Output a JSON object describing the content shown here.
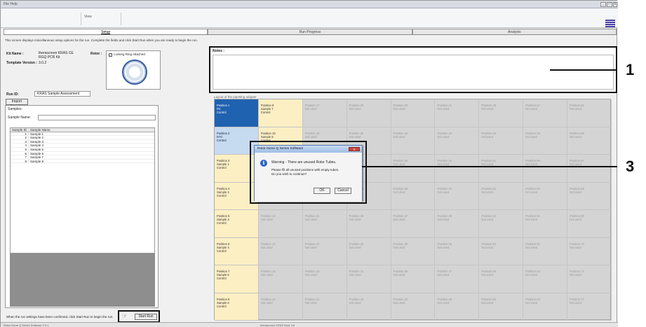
{
  "menubar": {
    "text": "File  Help"
  },
  "toolbar": {
    "view_label": "View"
  },
  "tabs": [
    "Setup",
    "Run Progress",
    "Analysis"
  ],
  "setup": {
    "info_text": "This screen displays miscellaneous setup options for the run. Complete the fields and click Start Run when you are ready to begin the run.",
    "kit_name_label": "Kit Name :",
    "kit_name_value_1": "therascreen KRAS CE",
    "kit_name_value_2": "RGQ PCR Kit",
    "template_version_label": "Template Version :",
    "template_version_value": "3.0.2",
    "rotor_label": "Rotor :",
    "locking_ring_label": "Locking Ring Attached",
    "run_id_label": "Run ID:",
    "run_id_value": "KRAS Sample Assessment",
    "import_samples_label": "Import Samples",
    "samples_label": "Samples:",
    "sample_name_label": "Sample Name:",
    "sample_name_value": "",
    "table_headers": [
      "Sample ID",
      "Sample Name"
    ],
    "samples": [
      {
        "id": "1",
        "name": "Sample 1"
      },
      {
        "id": "2",
        "name": "Sample 2"
      },
      {
        "id": "3",
        "name": "Sample 3"
      },
      {
        "id": "4",
        "name": "Sample 4"
      },
      {
        "id": "5",
        "name": "Sample 5"
      },
      {
        "id": "6",
        "name": "Sample 6"
      },
      {
        "id": "7",
        "name": "Sample 7"
      },
      {
        "id": "8",
        "name": "Sample 8"
      }
    ],
    "bottom_message": "When the run settings have been confirmed, click Start Run to begin the run.",
    "start_run_label": "Start Run",
    "notes_label": "Notes :",
    "grid_caption": "Layout of the pipetting adapter"
  },
  "grid": {
    "columns": [
      [
        {
          "lines": [
            "Position 1",
            "PC",
            "Control"
          ],
          "kind": "pc"
        },
        {
          "lines": [
            "Position 2",
            "NTC",
            "Control"
          ],
          "kind": "ntc"
        },
        {
          "lines": [
            "Position 3",
            "Sample 1",
            "Control"
          ],
          "kind": "sample"
        },
        {
          "lines": [
            "Position 4",
            "Sample 2",
            "Control"
          ],
          "kind": "sample"
        },
        {
          "lines": [
            "Position 5",
            "Sample 3",
            "Control"
          ],
          "kind": "sample"
        },
        {
          "lines": [
            "Position 6",
            "Sample 4",
            "Control"
          ],
          "kind": "sample"
        },
        {
          "lines": [
            "Position 7",
            "Sample 5",
            "Control"
          ],
          "kind": "sample"
        },
        {
          "lines": [
            "Position 8",
            "Sample 6",
            "Control"
          ],
          "kind": "sample"
        }
      ],
      [
        {
          "lines": [
            "Position 9",
            "Sample 7",
            "Control"
          ],
          "kind": "sample"
        },
        {
          "lines": [
            "Position 10",
            "Sample 8",
            "Control"
          ],
          "kind": "sample"
        },
        {
          "lines": [
            "Position 11",
            "Not used"
          ],
          "kind": "unused"
        },
        {
          "lines": [
            "Position 12",
            "Not used"
          ],
          "kind": "unused"
        },
        {
          "lines": [
            "Position 13",
            "Not used"
          ],
          "kind": "unused"
        },
        {
          "lines": [
            "Position 14",
            "Not used"
          ],
          "kind": "unused"
        },
        {
          "lines": [
            "Position 15",
            "Not used"
          ],
          "kind": "unused"
        },
        {
          "lines": [
            "Position 16",
            "Not used"
          ],
          "kind": "unused"
        }
      ],
      [
        {
          "lines": [
            "Position 17",
            "Not used"
          ],
          "kind": "unused"
        },
        {
          "lines": [
            "Position 18",
            "Not used"
          ],
          "kind": "unused"
        },
        {
          "lines": [
            "Position 19",
            "Not used"
          ],
          "kind": "unused"
        },
        {
          "lines": [
            "Position 20",
            "Not used"
          ],
          "kind": "unused"
        },
        {
          "lines": [
            "Position 21",
            "Not used"
          ],
          "kind": "unused"
        },
        {
          "lines": [
            "Position 22",
            "Not used"
          ],
          "kind": "unused"
        },
        {
          "lines": [
            "Position 23",
            "Not used"
          ],
          "kind": "unused"
        },
        {
          "lines": [
            "Position 24",
            "Not used"
          ],
          "kind": "unused"
        }
      ],
      [
        {
          "lines": [
            "Position 25",
            "Not used"
          ],
          "kind": "unused"
        },
        {
          "lines": [
            "Position 26",
            "Not used"
          ],
          "kind": "unused"
        },
        {
          "lines": [
            "Position 27",
            "Not used"
          ],
          "kind": "unused"
        },
        {
          "lines": [
            "Position 28",
            "Not used"
          ],
          "kind": "unused"
        },
        {
          "lines": [
            "Position 29",
            "Not used"
          ],
          "kind": "unused"
        },
        {
          "lines": [
            "Position 30",
            "Not used"
          ],
          "kind": "unused"
        },
        {
          "lines": [
            "Position 31",
            "Not used"
          ],
          "kind": "unused"
        },
        {
          "lines": [
            "Position 32",
            "Not used"
          ],
          "kind": "unused"
        }
      ],
      [
        {
          "lines": [
            "Position 33",
            "Not used"
          ],
          "kind": "unused"
        },
        {
          "lines": [
            "Position 34",
            "Not used"
          ],
          "kind": "unused"
        },
        {
          "lines": [
            "Position 35",
            "Not used"
          ],
          "kind": "unused"
        },
        {
          "lines": [
            "Position 36",
            "Not used"
          ],
          "kind": "unused"
        },
        {
          "lines": [
            "Position 37",
            "Not used"
          ],
          "kind": "unused"
        },
        {
          "lines": [
            "Position 38",
            "Not used"
          ],
          "kind": "unused"
        },
        {
          "lines": [
            "Position 39",
            "Not used"
          ],
          "kind": "unused"
        },
        {
          "lines": [
            "Position 40",
            "Not used"
          ],
          "kind": "unused"
        }
      ],
      [
        {
          "lines": [
            "Position 41",
            "Not used"
          ],
          "kind": "unused"
        },
        {
          "lines": [
            "Position 42",
            "Not used"
          ],
          "kind": "unused"
        },
        {
          "lines": [
            "Position 43",
            "Not used"
          ],
          "kind": "unused"
        },
        {
          "lines": [
            "Position 44",
            "Not used"
          ],
          "kind": "unused"
        },
        {
          "lines": [
            "Position 45",
            "Not used"
          ],
          "kind": "unused"
        },
        {
          "lines": [
            "Position 46",
            "Not used"
          ],
          "kind": "unused"
        },
        {
          "lines": [
            "Position 47",
            "Not used"
          ],
          "kind": "unused"
        },
        {
          "lines": [
            "Position 48",
            "Not used"
          ],
          "kind": "unused"
        }
      ],
      [
        {
          "lines": [
            "Position 49",
            "Not used"
          ],
          "kind": "unused"
        },
        {
          "lines": [
            "Position 50",
            "Not used"
          ],
          "kind": "unused"
        },
        {
          "lines": [
            "Position 51",
            "Not used"
          ],
          "kind": "unused"
        },
        {
          "lines": [
            "Position 52",
            "Not used"
          ],
          "kind": "unused"
        },
        {
          "lines": [
            "Position 53",
            "Not used"
          ],
          "kind": "unused"
        },
        {
          "lines": [
            "Position 54",
            "Not used"
          ],
          "kind": "unused"
        },
        {
          "lines": [
            "Position 55",
            "Not used"
          ],
          "kind": "unused"
        },
        {
          "lines": [
            "Position 56",
            "Not used"
          ],
          "kind": "unused"
        }
      ],
      [
        {
          "lines": [
            "Position 57",
            "Not used"
          ],
          "kind": "unused"
        },
        {
          "lines": [
            "Position 58",
            "Not used"
          ],
          "kind": "unused"
        },
        {
          "lines": [
            "Position 59",
            "Not used"
          ],
          "kind": "unused"
        },
        {
          "lines": [
            "Position 60",
            "Not used"
          ],
          "kind": "unused"
        },
        {
          "lines": [
            "Position 61",
            "Not used"
          ],
          "kind": "unused"
        },
        {
          "lines": [
            "Position 62",
            "Not used"
          ],
          "kind": "unused"
        },
        {
          "lines": [
            "Position 63",
            "Not used"
          ],
          "kind": "unused"
        },
        {
          "lines": [
            "Position 64",
            "Not used"
          ],
          "kind": "unused"
        }
      ],
      [
        {
          "lines": [
            "Position 65",
            "Not used"
          ],
          "kind": "unused"
        },
        {
          "lines": [
            "Position 66",
            "Not used"
          ],
          "kind": "unused"
        },
        {
          "lines": [
            "Position 67",
            "Not used"
          ],
          "kind": "unused"
        },
        {
          "lines": [
            "Position 68",
            "Not used"
          ],
          "kind": "unused"
        },
        {
          "lines": [
            "Position 69",
            "Not used"
          ],
          "kind": "unused"
        },
        {
          "lines": [
            "Position 70",
            "Not used"
          ],
          "kind": "unused"
        },
        {
          "lines": [
            "Position 71",
            "Not used"
          ],
          "kind": "unused"
        },
        {
          "lines": [
            "Position 72",
            "Not used"
          ],
          "kind": "unused"
        }
      ]
    ]
  },
  "dialog": {
    "title": "Rotor-Gene Q Series Software",
    "close_label": "X",
    "warning": "Warning - There are unused Rotor Tubes.",
    "line2": "Please fill all unused positions with empty tubes.",
    "line3": "Do you wish to continue?",
    "ok_label": "OK",
    "cancel_label": "Cancel",
    "icon": "info-icon"
  },
  "statusbar": {
    "left": "Rotor-Gene Q Series Software 2.3.1",
    "center": "therascreen KRAS Mod. Kit"
  },
  "callouts": [
    "1",
    "3"
  ],
  "colors": {
    "pc": "#1f62b0",
    "ntc": "#c6daf0",
    "sample": "#fcefc4",
    "unused": "#d4d4d4"
  }
}
